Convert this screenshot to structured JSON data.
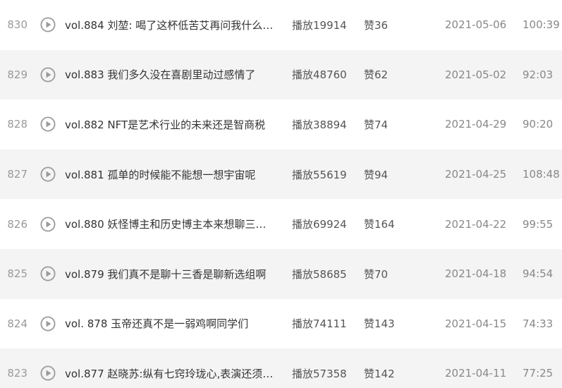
{
  "episodes": [
    {
      "num": "830",
      "title": "vol.884 刘堃: 喝了这杯低苦艾再问我什么…",
      "plays": "播放19914",
      "likes": "赞36",
      "date": "2021-05-06",
      "duration": "100:39"
    },
    {
      "num": "829",
      "title": "vol.883 我们多久没在喜剧里动过感情了",
      "plays": "播放48760",
      "likes": "赞62",
      "date": "2021-05-02",
      "duration": "92:03"
    },
    {
      "num": "828",
      "title": "vol.882 NFT是艺术行业的未来还是智商税",
      "plays": "播放38894",
      "likes": "赞74",
      "date": "2021-04-29",
      "duration": "90:20"
    },
    {
      "num": "827",
      "title": "vol.881 孤单的时候能不能想一想宇宙呢",
      "plays": "播放55619",
      "likes": "赞94",
      "date": "2021-04-25",
      "duration": "108:48"
    },
    {
      "num": "826",
      "title": "vol.880 妖怪博主和历史博主本来想聊三…",
      "plays": "播放69924",
      "likes": "赞164",
      "date": "2021-04-22",
      "duration": "99:55"
    },
    {
      "num": "825",
      "title": "vol.879 我们真不是聊十三香是聊新选组啊",
      "plays": "播放58685",
      "likes": "赞70",
      "date": "2021-04-18",
      "duration": "94:54"
    },
    {
      "num": "824",
      "title": "vol. 878 玉帝还真不是一弱鸡啊同学们",
      "plays": "播放74111",
      "likes": "赞143",
      "date": "2021-04-15",
      "duration": "74:33"
    },
    {
      "num": "823",
      "title": "vol.877 赵晓苏:纵有七窍玲珑心,表演还须…",
      "plays": "播放57358",
      "likes": "赞142",
      "date": "2021-04-11",
      "duration": "77:25"
    }
  ],
  "icons": {
    "play": "play-circle-icon"
  },
  "colors": {
    "icon": "#9a9a9a",
    "row_alt": "#f4f4f4",
    "text": "#333333",
    "muted": "#888888"
  }
}
